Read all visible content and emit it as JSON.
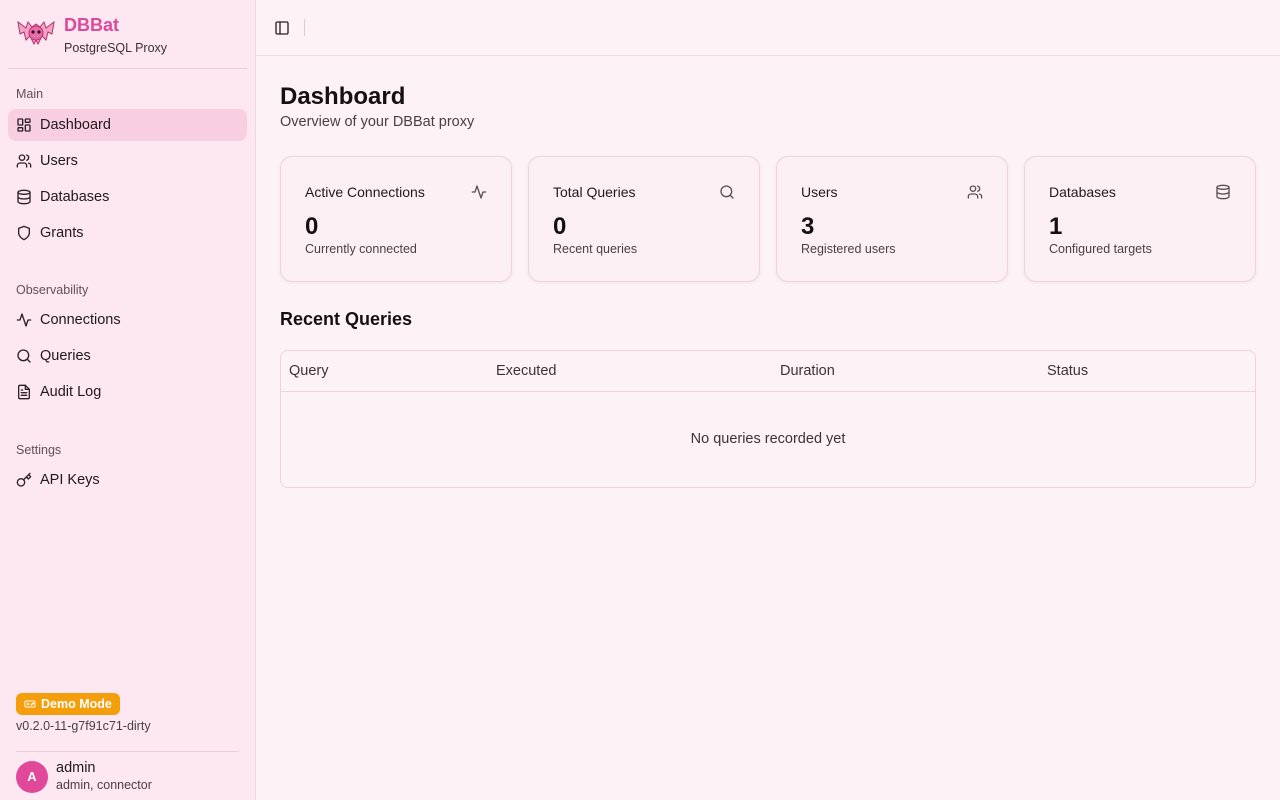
{
  "app": {
    "name": "DBBat",
    "subtitle": "PostgreSQL Proxy"
  },
  "sidebar": {
    "sections": [
      {
        "heading": "Main",
        "items": [
          {
            "label": "Dashboard",
            "icon": "layout-dashboard-icon",
            "active": true
          },
          {
            "label": "Users",
            "icon": "users-icon"
          },
          {
            "label": "Databases",
            "icon": "database-icon"
          },
          {
            "label": "Grants",
            "icon": "shield-icon"
          }
        ]
      },
      {
        "heading": "Observability",
        "items": [
          {
            "label": "Connections",
            "icon": "activity-icon"
          },
          {
            "label": "Queries",
            "icon": "search-icon"
          },
          {
            "label": "Audit Log",
            "icon": "file-text-icon"
          }
        ]
      },
      {
        "heading": "Settings",
        "items": [
          {
            "label": "API Keys",
            "icon": "key-icon"
          }
        ]
      }
    ],
    "demo_badge": "Demo Mode",
    "version": "v0.2.0-11-g7f91c71-dirty",
    "user": {
      "initial": "A",
      "name": "admin",
      "roles": "admin, connector"
    }
  },
  "page": {
    "title": "Dashboard",
    "subtitle": "Overview of your DBBat proxy"
  },
  "stats": [
    {
      "title": "Active Connections",
      "value": "0",
      "description": "Currently connected",
      "icon": "activity-icon"
    },
    {
      "title": "Total Queries",
      "value": "0",
      "description": "Recent queries",
      "icon": "search-icon"
    },
    {
      "title": "Users",
      "value": "3",
      "description": "Registered users",
      "icon": "users-icon"
    },
    {
      "title": "Databases",
      "value": "1",
      "description": "Configured targets",
      "icon": "database-icon"
    }
  ],
  "recent_queries": {
    "title": "Recent Queries",
    "columns": [
      "Query",
      "Executed",
      "Duration",
      "Status"
    ],
    "empty_message": "No queries recorded yet"
  },
  "colors": {
    "brand": "#e0489a",
    "sidebar_bg": "#fde7f0",
    "active_item_bg": "#f8cfe0",
    "demo_badge": "#f59e0b",
    "page_bg": "#fdf2f6"
  }
}
